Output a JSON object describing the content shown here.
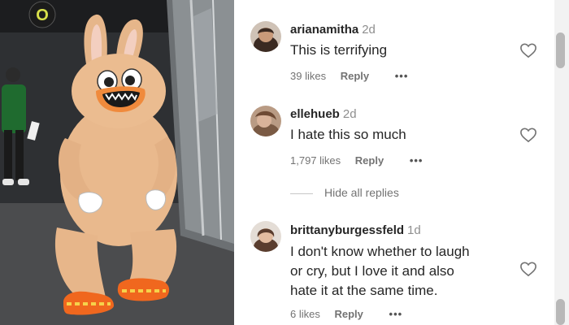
{
  "comments": [
    {
      "username": "arianamitha",
      "time": "2d",
      "text_lines": [
        "This is terrifying"
      ],
      "likes": "39 likes",
      "reply_label": "Reply",
      "more_label": "•••",
      "avatar_color": "#3b2a22"
    },
    {
      "username": "ellehueb",
      "time": "2d",
      "text_lines": [
        "I hate this so much"
      ],
      "likes": "1,797 likes",
      "reply_label": "Reply",
      "more_label": "•••",
      "avatar_color": "#7a5a44"
    },
    {
      "username": "brittanyburgessfeld",
      "time": "1d",
      "text_lines": [
        "I don't know whether to laugh",
        "or cry, but I love it and also",
        "hate it at the same time."
      ],
      "likes": "6 likes",
      "reply_label": "Reply",
      "more_label": "•••",
      "avatar_color": "#5a3d2e"
    }
  ],
  "hide_replies_label": "Hide all replies",
  "photo": {
    "mascot": "bunny-duck-mascot",
    "logo_text": "O"
  },
  "colors": {
    "text": "#262626",
    "secondary": "#737373",
    "mascot_fur": "#e9b98d",
    "shoe": "#f0671e"
  }
}
